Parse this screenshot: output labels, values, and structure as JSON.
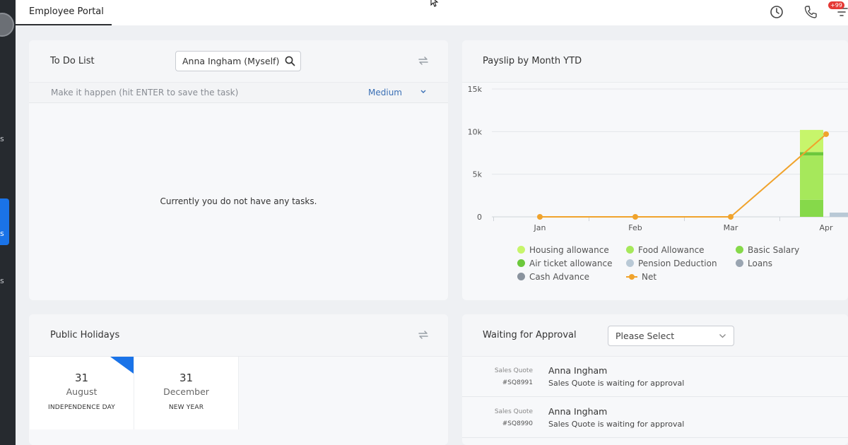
{
  "sidebar": {
    "labels": [
      "s",
      "s",
      "s"
    ]
  },
  "header": {
    "tab": "Employee Portal",
    "notification_count": "+99"
  },
  "todo": {
    "title": "To Do List",
    "search_value": "Anna Ingham (Myself)",
    "placeholder": "Make it happen (hit ENTER to save the task)",
    "priority": "Medium",
    "empty_message": "Currently you do not have any tasks."
  },
  "payslip": {
    "title": "Payslip by Month YTD",
    "legend": [
      {
        "label": "Housing allowance",
        "color": "#c7f56b"
      },
      {
        "label": "Food Allowance",
        "color": "#a6e85b"
      },
      {
        "label": "Basic Salary",
        "color": "#86d94a"
      },
      {
        "label": "Air ticket allowance",
        "color": "#6cc83c"
      },
      {
        "label": "Pension Deduction",
        "color": "#b9c9d6"
      },
      {
        "label": "Loans",
        "color": "#9aa5b1"
      },
      {
        "label": "Cash Advance",
        "color": "#8a939e"
      },
      {
        "label": "Net",
        "color": "#f0a32c"
      }
    ]
  },
  "chart_data": {
    "type": "bar",
    "categories": [
      "Jan",
      "Feb",
      "Mar",
      "Apr"
    ],
    "yticks": [
      "0",
      "5k",
      "10k",
      "15k"
    ],
    "ylim": [
      0,
      15000
    ],
    "series": [
      {
        "name": "Basic Salary",
        "type": "bar",
        "values": [
          0,
          0,
          0,
          2000
        ]
      },
      {
        "name": "Food Allowance",
        "type": "bar",
        "values": [
          0,
          0,
          0,
          5200
        ]
      },
      {
        "name": "Air ticket allowance",
        "type": "bar",
        "values": [
          0,
          0,
          0,
          400
        ]
      },
      {
        "name": "Housing allowance",
        "type": "bar",
        "values": [
          0,
          0,
          0,
          2600
        ]
      },
      {
        "name": "Pension Deduction",
        "type": "bar",
        "values": [
          0,
          0,
          0,
          500
        ]
      },
      {
        "name": "Net",
        "type": "line",
        "values": [
          0,
          0,
          0,
          9700
        ]
      }
    ]
  },
  "holidays": {
    "title": "Public Holidays",
    "items": [
      {
        "day": "31",
        "month": "August",
        "name": "INDEPENDENCE DAY"
      },
      {
        "day": "31",
        "month": "December",
        "name": "NEW YEAR"
      }
    ]
  },
  "approval": {
    "title": "Waiting for Approval",
    "select_value": "Please Select",
    "items": [
      {
        "type": "Sales Quote",
        "number": "#SQ8991",
        "name": "Anna Ingham",
        "message": "Sales Quote is waiting for approval"
      },
      {
        "type": "Sales Quote",
        "number": "#SQ8990",
        "name": "Anna Ingham",
        "message": "Sales Quote is waiting for approval"
      }
    ]
  }
}
